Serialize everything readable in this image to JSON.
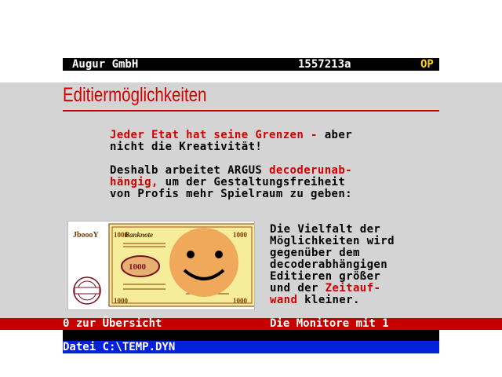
{
  "header": {
    "provider": "Augur GmbH",
    "page_id": "1557213a",
    "flag": "OP"
  },
  "title": "Editiermöglichkeiten",
  "para1": {
    "line1_red": "Jeder Etat hat seine Grenzen -",
    "line1_black": " aber",
    "line2": "nicht die Kreativität!"
  },
  "para2": {
    "line1_black": "Deshalb arbeitet ARGUS ",
    "line1_red": "decoderunab-",
    "line2_red": "hängig,",
    "line2_black": " um der Gestaltungsfreiheit",
    "line3": "von Profis mehr Spielraum zu geben:"
  },
  "para3": {
    "line1": "Die Vielfalt der",
    "line2": "Möglichkeiten wird",
    "line3": "gegenüber dem",
    "line4": "decoderabhängigen",
    "line5": "Editieren größer",
    "line6_black": "und der ",
    "line6_red": "Zeitauf-",
    "line7_red": "wand",
    "line7_black": " kleiner."
  },
  "image": {
    "banner_text": "JboooY",
    "denomination": "1000",
    "corner_value": "1000",
    "note_label": "Banknote",
    "icon": "smiley-icon"
  },
  "footer": {
    "nav_left": "0 zur Übersicht",
    "nav_right": "Die Monitore mit 1",
    "file_label": "Datei C:\\TEMP.DYN"
  },
  "colors": {
    "accent_red": "#d00000",
    "nav_red": "#c40000",
    "file_blue": "#0022dd",
    "flag_yellow": "#ffd200",
    "body_grey": "#d4d4d4"
  }
}
